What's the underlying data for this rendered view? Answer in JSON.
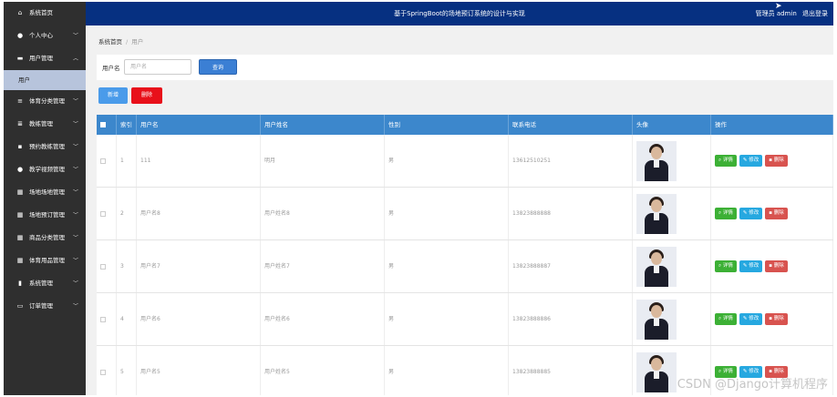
{
  "topbar": {
    "title": "基于SpringBoot的场地预订系统的设计与实现",
    "user_label": "管理员 admin",
    "logout": "退出登录"
  },
  "sidebar": {
    "items": [
      {
        "label": "系统首页",
        "icon": "home-icon",
        "glyph": "⌂",
        "has_chevron": false
      },
      {
        "label": "个人中心",
        "icon": "user-icon",
        "glyph": "●",
        "has_chevron": true
      },
      {
        "label": "用户管理",
        "icon": "id-card-icon",
        "glyph": "▬",
        "has_chevron": true,
        "expanded": true
      },
      {
        "label": "体育分类管理",
        "icon": "sliders-icon",
        "glyph": "≡",
        "has_chevron": true
      },
      {
        "label": "教练管理",
        "icon": "list-icon",
        "glyph": "≣",
        "has_chevron": true
      },
      {
        "label": "预约教练管理",
        "icon": "chat-icon",
        "glyph": "▪",
        "has_chevron": true
      },
      {
        "label": "教学视频管理",
        "icon": "person-icon",
        "glyph": "●",
        "has_chevron": true
      },
      {
        "label": "场地场地管理",
        "icon": "grid-icon",
        "glyph": "▦",
        "has_chevron": true
      },
      {
        "label": "场地预订管理",
        "icon": "grid-icon",
        "glyph": "▦",
        "has_chevron": true
      },
      {
        "label": "商品分类管理",
        "icon": "table-icon",
        "glyph": "▦",
        "has_chevron": true
      },
      {
        "label": "体育用品管理",
        "icon": "grid-icon",
        "glyph": "▦",
        "has_chevron": true
      },
      {
        "label": "系统管理",
        "icon": "chart-icon",
        "glyph": "▮",
        "has_chevron": true
      },
      {
        "label": "订单管理",
        "icon": "monitor-icon",
        "glyph": "▭",
        "has_chevron": true
      }
    ],
    "sub_item": "用户"
  },
  "breadcrumb": {
    "home": "系统首页",
    "current": "用户",
    "sep": "/"
  },
  "search": {
    "label": "用户名",
    "placeholder": "用户名",
    "button": "查询"
  },
  "actions": {
    "add": "新增",
    "delete": "删除"
  },
  "table": {
    "headers": [
      "",
      "索引",
      "用户名",
      "用户姓名",
      "性别",
      "联系电话",
      "头像",
      "操作"
    ],
    "rows": [
      {
        "index": "1",
        "username": "111",
        "name": "明月",
        "gender": "男",
        "phone": "13612510251"
      },
      {
        "index": "2",
        "username": "用户名8",
        "name": "用户姓名8",
        "gender": "男",
        "phone": "13823888888"
      },
      {
        "index": "3",
        "username": "用户名7",
        "name": "用户姓名7",
        "gender": "男",
        "phone": "13823888887"
      },
      {
        "index": "4",
        "username": "用户名6",
        "name": "用户姓名6",
        "gender": "男",
        "phone": "13823888886"
      },
      {
        "index": "5",
        "username": "用户名5",
        "name": "用户姓名5",
        "gender": "男",
        "phone": "13823888885"
      }
    ],
    "op_labels": {
      "detail": "详情",
      "edit": "修改",
      "delete": "删除"
    }
  },
  "watermark": "CSDN @Django计算机程序"
}
